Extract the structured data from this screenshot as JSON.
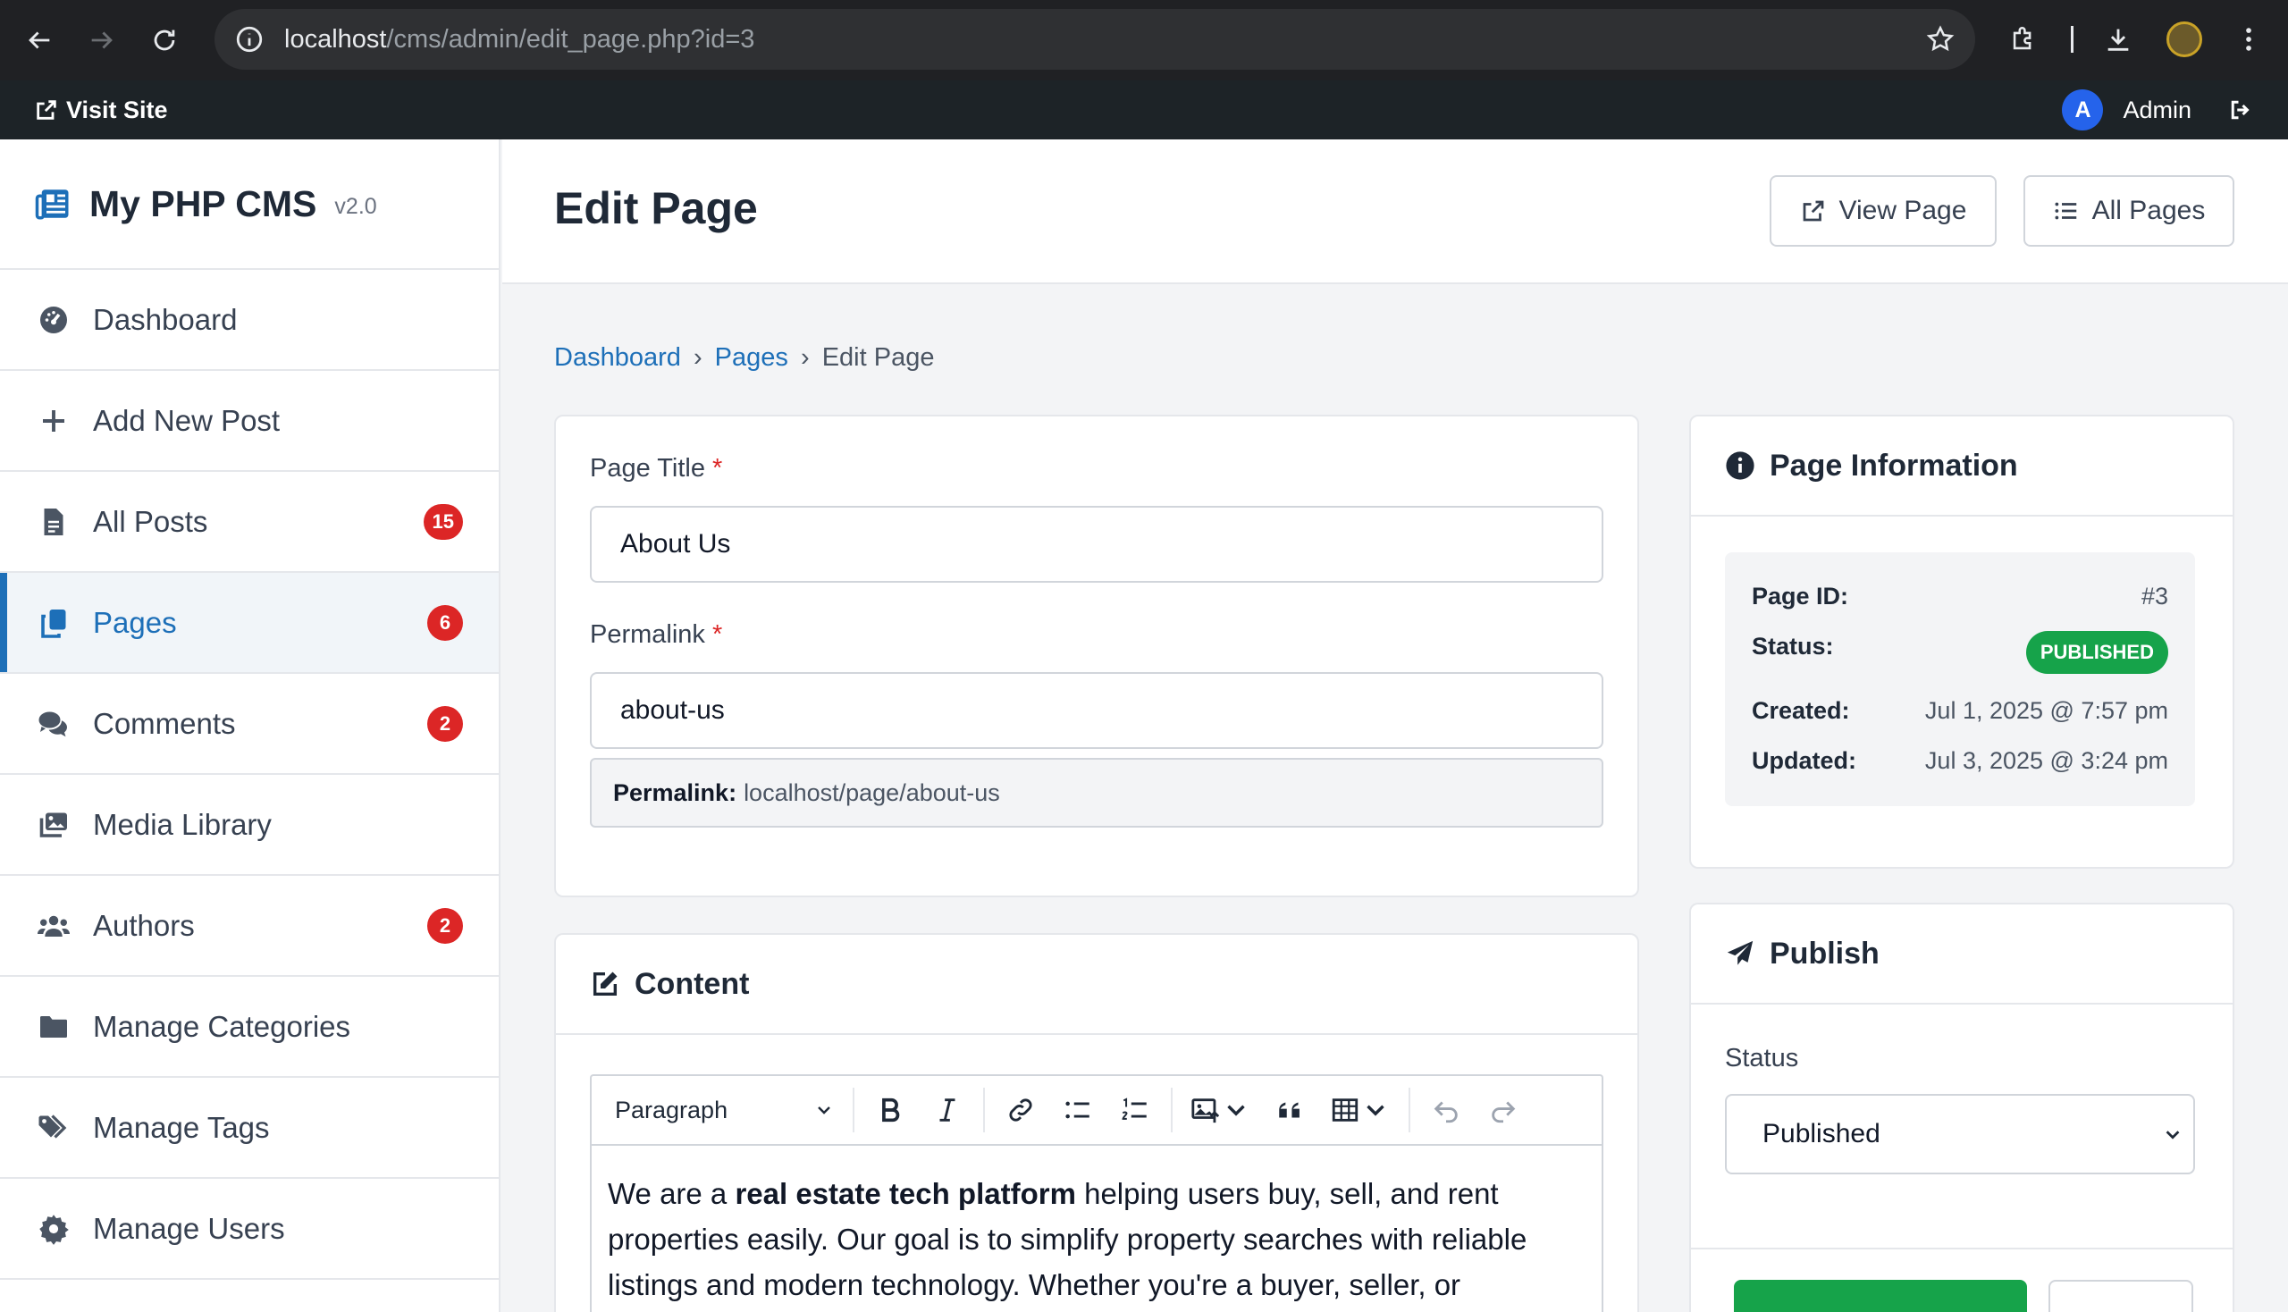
{
  "browser": {
    "url_host": "localhost",
    "url_path": "/cms/admin/edit_page.php?id=3"
  },
  "admin_bar": {
    "visit_site": "Visit Site",
    "avatar_letter": "A",
    "user_name": "Admin"
  },
  "sidebar": {
    "brand_name": "My PHP CMS",
    "brand_version": "v2.0",
    "items": [
      {
        "label": "Dashboard",
        "icon": "dashboard-icon",
        "badge": ""
      },
      {
        "label": "Add New Post",
        "icon": "plus-icon",
        "badge": ""
      },
      {
        "label": "All Posts",
        "icon": "file-icon",
        "badge": "15"
      },
      {
        "label": "Pages",
        "icon": "copy-icon",
        "badge": "6"
      },
      {
        "label": "Comments",
        "icon": "comments-icon",
        "badge": "2"
      },
      {
        "label": "Media Library",
        "icon": "images-icon",
        "badge": ""
      },
      {
        "label": "Authors",
        "icon": "users-icon",
        "badge": "2"
      },
      {
        "label": "Manage Categories",
        "icon": "folder-icon",
        "badge": ""
      },
      {
        "label": "Manage Tags",
        "icon": "tags-icon",
        "badge": ""
      },
      {
        "label": "Manage Users",
        "icon": "gear-icon",
        "badge": ""
      }
    ]
  },
  "header": {
    "title": "Edit Page",
    "view_page": "View Page",
    "all_pages": "All Pages"
  },
  "breadcrumb": {
    "dashboard": "Dashboard",
    "pages": "Pages",
    "current": "Edit Page",
    "separator": "›"
  },
  "form": {
    "title_label": "Page Title",
    "title_value": "About Us",
    "permalink_label": "Permalink",
    "permalink_value": "about-us",
    "permalink_preview_label": "Permalink:",
    "permalink_preview_value": "localhost/page/about-us",
    "required_mark": "*"
  },
  "content": {
    "heading": "Content",
    "block_format": "Paragraph",
    "text_before": "We are a ",
    "text_bold": "real estate tech platform",
    "text_after": " helping users buy, sell, and rent properties easily. Our goal is to simplify property searches with reliable listings and modern technology. Whether you're a buyer, seller, or"
  },
  "page_info": {
    "heading": "Page Information",
    "id_label": "Page ID:",
    "id_value": "#3",
    "status_label": "Status:",
    "status_value": "PUBLISHED",
    "created_label": "Created:",
    "created_value": "Jul 1, 2025 @ 7:57 pm",
    "updated_label": "Updated:",
    "updated_value": "Jul 3, 2025 @ 3:24 pm"
  },
  "publish": {
    "heading": "Publish",
    "status_label": "Status",
    "status_selected": "Published"
  },
  "colors": {
    "accent": "#1d6fb8",
    "badge": "#dc2626",
    "success": "#16a34a",
    "admin_bar": "#1d2327"
  }
}
